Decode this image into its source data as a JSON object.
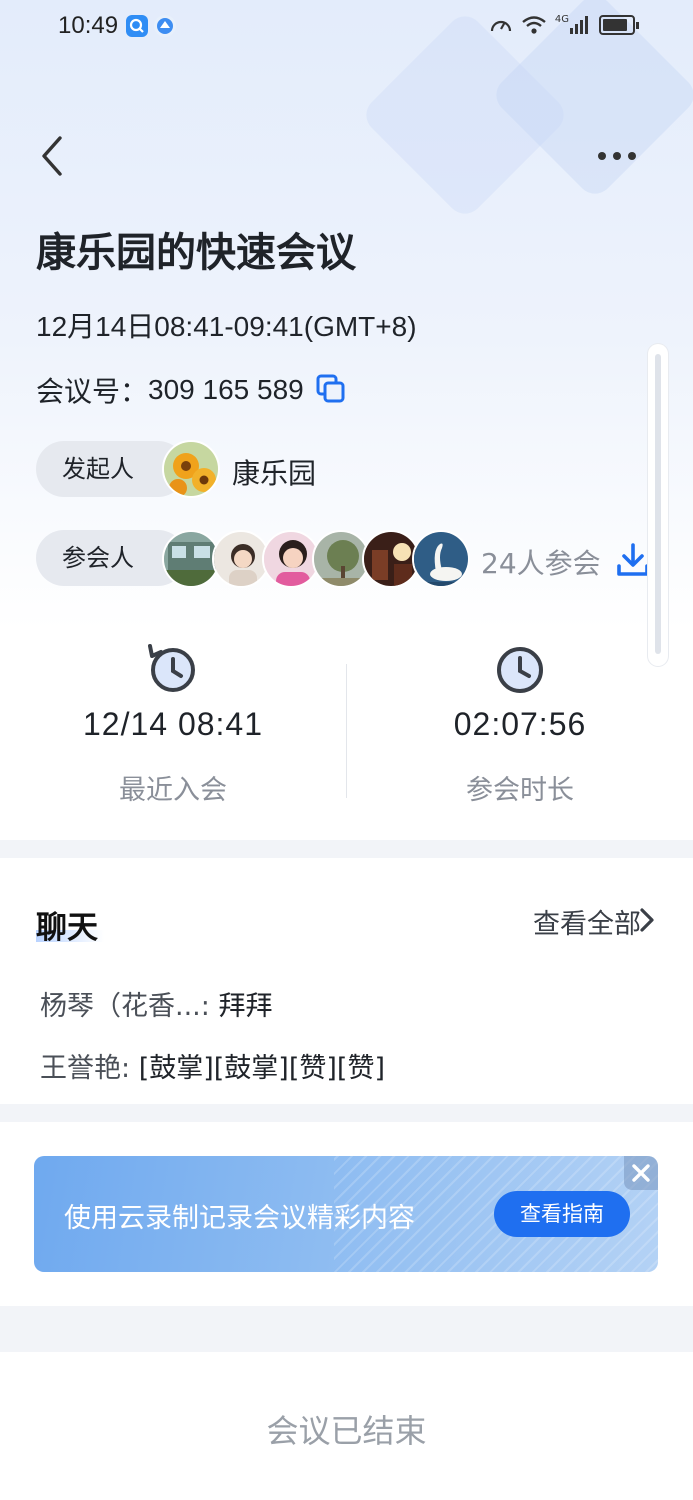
{
  "status_bar": {
    "time": "10:49",
    "network": "4G"
  },
  "meeting": {
    "title": "康乐园的快速会议",
    "timeline": "12月14日08:41-09:41(GMT+8)",
    "id_label": "会议号：",
    "id_value": "309 165 589",
    "initiator_label": "发起人",
    "initiator_name": "康乐园",
    "participants_label": "参会人",
    "participant_count": "24人参会"
  },
  "stats": {
    "last_join_value": "12/14 08:41",
    "last_join_label": "最近入会",
    "duration_value": "02:07:56",
    "duration_label": "参会时长"
  },
  "chat": {
    "title": "聊天",
    "view_all": "查看全部",
    "messages": [
      {
        "sender": "杨琴（花香...:",
        "text": "拜拜"
      },
      {
        "sender": "王誉艳:",
        "text": "[鼓掌][鼓掌][赞][赞]"
      }
    ]
  },
  "promo": {
    "text": "使用云录制记录会议精彩内容",
    "button": "查看指南"
  },
  "footer": {
    "status": "会议已结束"
  },
  "colors": {
    "accent": "#1f6ff0",
    "muted_text": "#8a8f99"
  }
}
